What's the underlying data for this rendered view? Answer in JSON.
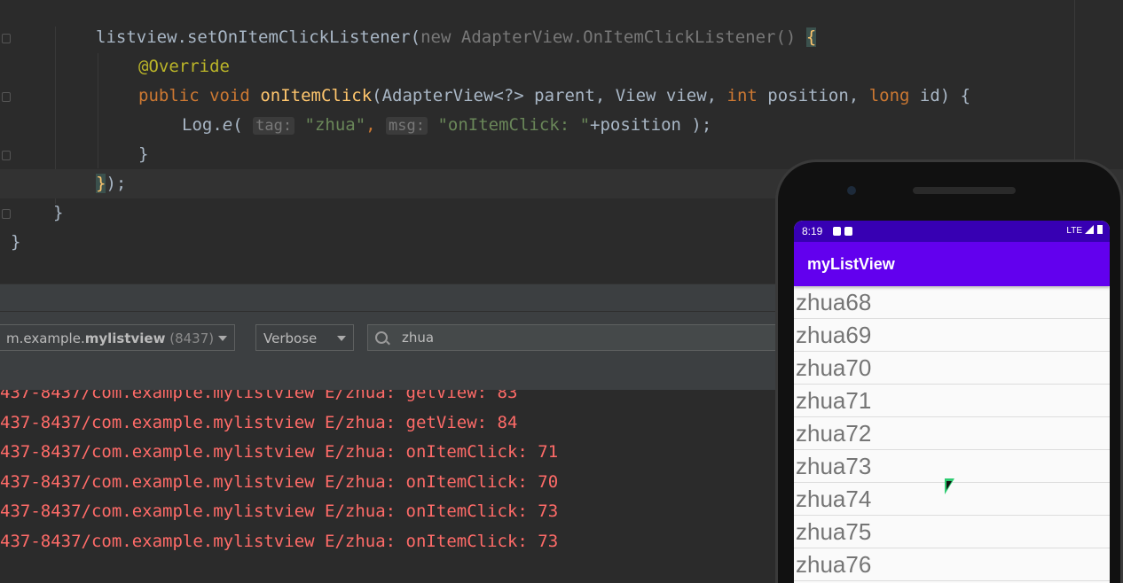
{
  "editor": {
    "lines": [
      {
        "kind": "listener",
        "obj": "listview",
        "method": "setOnItemClickListener",
        "new_kw": "new",
        "cls": "AdapterView.OnItemClickListener",
        "tail": "()",
        "brace": "{"
      },
      {
        "kind": "annotation",
        "text": "@Override"
      },
      {
        "kind": "signature",
        "public": "public",
        "void": "void",
        "name": "onItemClick",
        "params_a": "(AdapterView<?> parent, View view, ",
        "int_kw": "int",
        "params_b": " position, ",
        "long_kw": "long",
        "params_c": " id) {"
      },
      {
        "kind": "log",
        "a": "Log.",
        "e": "e",
        "b": "( ",
        "hint_tag": "tag:",
        "str_tag": "\"zhua\"",
        "comma": ", ",
        "hint_msg": "msg:",
        "str_msg": "\"onItemClick: \"",
        "rest": "+position );"
      },
      {
        "kind": "plain",
        "text": "}"
      },
      {
        "kind": "close",
        "brace": "}",
        "rest": ");"
      },
      {
        "kind": "plain",
        "text": "}"
      },
      {
        "kind": "plain",
        "text": "}"
      }
    ]
  },
  "logcat_toolbar": {
    "process_prefix": "m.example.",
    "process_bold": "mylistview",
    "process_pid": " (8437)",
    "level": "Verbose",
    "search_value": "zhua"
  },
  "log_lines": [
    "437-8437/com.example.mylistview E/zhua: getView: 83",
    "437-8437/com.example.mylistview E/zhua: getView: 84",
    "437-8437/com.example.mylistview E/zhua: onItemClick: 71",
    "437-8437/com.example.mylistview E/zhua: onItemClick: 70",
    "437-8437/com.example.mylistview E/zhua: onItemClick: 73",
    "437-8437/com.example.mylistview E/zhua: onItemClick: 73"
  ],
  "phone": {
    "time": "8:19",
    "network": "LTE",
    "app_title": "myListView",
    "items": [
      "zhua68",
      "zhua69",
      "zhua70",
      "zhua71",
      "zhua72",
      "zhua73",
      "zhua74",
      "zhua75",
      "zhua76"
    ]
  },
  "colors": {
    "app_bar": "#6200ee",
    "status_bar": "#3700b3",
    "log_error": "#ff6b68",
    "editor_bg": "#2b2b2b"
  }
}
